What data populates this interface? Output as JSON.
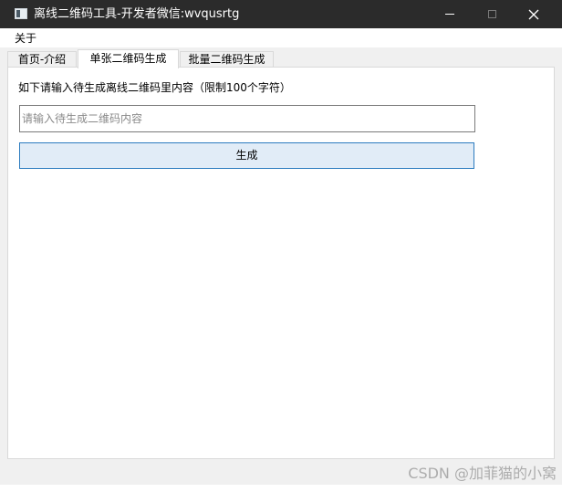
{
  "window": {
    "title": "离线二维码工具-开发者微信:wvqusrtg",
    "icon": "app-window-icon",
    "controls": {
      "minimize_icon": "minimize-icon",
      "maximize_icon": "maximize-icon",
      "close_icon": "close-icon",
      "close_glyph": "✕"
    },
    "colors": {
      "titlebar": "#2b2b2b",
      "button_border": "#2b7bbf",
      "button_fill": "#e1ecf7"
    }
  },
  "menu": {
    "items": [
      {
        "label": "关于"
      }
    ]
  },
  "tabs": [
    {
      "label": "首页-介绍",
      "active": false
    },
    {
      "label": "单张二维码生成",
      "active": true
    },
    {
      "label": "批量二维码生成",
      "active": false
    }
  ],
  "main": {
    "instruction": "如下请输入待生成离线二维码里内容（限制100个字符）",
    "input": {
      "value": "",
      "placeholder": "请输入待生成二维码内容"
    },
    "generate_label": "生成"
  },
  "watermark": "CSDN @加菲猫的小窝"
}
